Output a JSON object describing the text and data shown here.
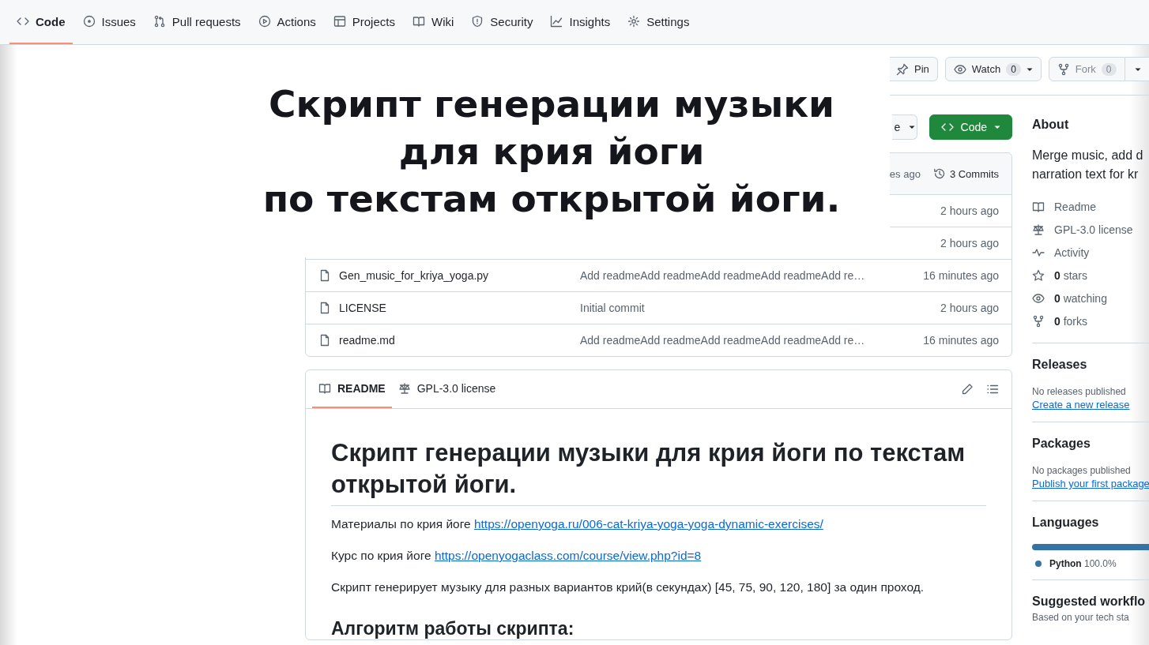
{
  "repo_nav": {
    "tabs": [
      {
        "label": "Code",
        "selected": true
      },
      {
        "label": "Issues",
        "selected": false
      },
      {
        "label": "Pull requests",
        "selected": false
      },
      {
        "label": "Actions",
        "selected": false
      },
      {
        "label": "Projects",
        "selected": false
      },
      {
        "label": "Wiki",
        "selected": false
      },
      {
        "label": "Security",
        "selected": false
      },
      {
        "label": "Insights",
        "selected": false
      },
      {
        "label": "Settings",
        "selected": false
      }
    ]
  },
  "overlay_title": {
    "lines": [
      "Скрипт генерации музыки",
      "для крия йоги",
      "по текстам открытой йоги."
    ]
  },
  "repo_actions": {
    "pin": "Pin",
    "watch": {
      "label": "Watch",
      "count": "0"
    },
    "fork": {
      "label": "Fork",
      "count": "0"
    }
  },
  "branch_button": {
    "label": "e"
  },
  "code_button": {
    "label": "Code"
  },
  "commit_bar": {
    "time": "es ago",
    "commits": "3 Commits"
  },
  "files": [
    {
      "time": "2 hours ago"
    },
    {
      "time": "2 hours ago"
    },
    {
      "name": "Gen_music_for_kriya_yoga.py",
      "message": "Add readmeAdd readmeAdd readmeAdd readmeAdd re…",
      "time": "16 minutes ago"
    },
    {
      "name": "LICENSE",
      "message": "Initial commit",
      "time": "2 hours ago"
    },
    {
      "name": "readme.md",
      "message": "Add readmeAdd readmeAdd readmeAdd readmeAdd re…",
      "time": "16 minutes ago"
    }
  ],
  "readme": {
    "tabs": [
      {
        "label": "README",
        "selected": true
      },
      {
        "label": "GPL-3.0 license",
        "selected": false
      }
    ],
    "title": "Скрипт генерации музыки для крия йоги по текстам открытой йоги.",
    "paragraphs": [
      {
        "text": "Материалы по крия йоге",
        "link": "https://openyoga.ru/006-cat-kriya-yoga-yoga-dynamic-exercises/"
      },
      {
        "text": "Курс по крия йоге",
        "link": "https://openyogaclass.com/course/view.php?id=8"
      },
      {
        "text": "Скрипт генерирует музыку для разных вариантов крий(в секундах) [45, 75, 90, 120, 180] за один проход."
      }
    ],
    "heading": "Алгоритм работы скрипта:"
  },
  "sidebar": {
    "about": {
      "title": "About",
      "description_lines": [
        "Merge music, add d",
        "narration text for kr"
      ],
      "links": [
        {
          "label": "Readme"
        },
        {
          "label": "GPL-3.0 license"
        },
        {
          "label": "Activity"
        },
        {
          "count": "0",
          "label": "stars"
        },
        {
          "count": "0",
          "label": "watching"
        },
        {
          "count": "0",
          "label": "forks"
        }
      ]
    },
    "releases": {
      "title": "Releases",
      "note": "No releases published",
      "link": "Create a new release"
    },
    "packages": {
      "title": "Packages",
      "note": "No packages published",
      "link": "Publish your first package"
    },
    "languages": {
      "title": "Languages",
      "items": [
        {
          "name": "Python",
          "percent": "100.0%",
          "color": "#3572a5",
          "level": 1
        }
      ]
    },
    "suggested": {
      "title": "Suggested workflo",
      "note": "Based on your tech sta"
    }
  }
}
